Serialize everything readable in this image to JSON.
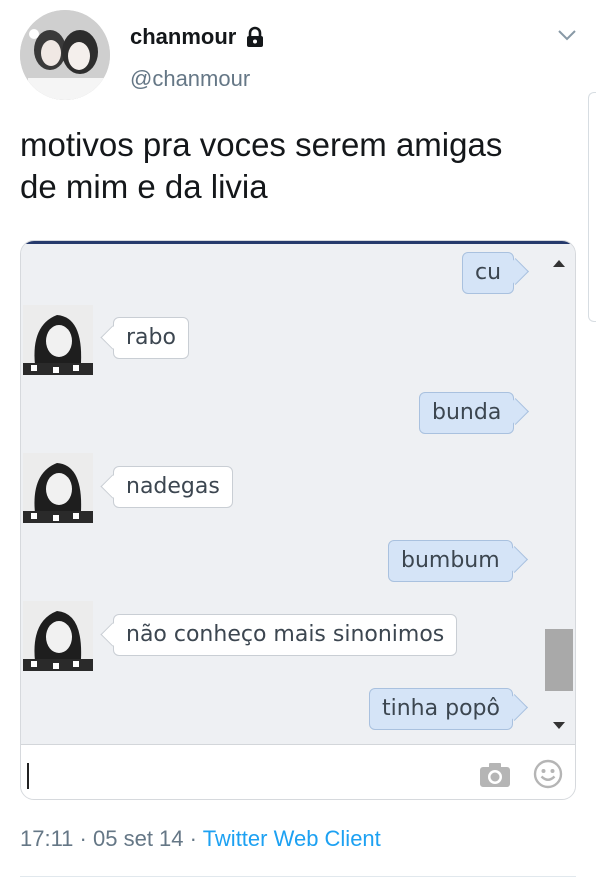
{
  "tweet": {
    "display_name": "chanmour",
    "handle": "@chanmour",
    "text_line1": "motivos pra voces serem amigas",
    "text_line2": "de mim e da livia",
    "time": "17:11",
    "separator": "·",
    "date": "05 set 14",
    "client": "Twitter Web Client"
  },
  "chat": {
    "messages": [
      {
        "from": "me",
        "text": "cu"
      },
      {
        "from": "them",
        "text": "rabo"
      },
      {
        "from": "me",
        "text": "bunda"
      },
      {
        "from": "them",
        "text": "nadegas"
      },
      {
        "from": "me",
        "text": "bumbum"
      },
      {
        "from": "them",
        "text": "não conheço mais sinonimos"
      },
      {
        "from": "me",
        "text": "tinha popô"
      }
    ]
  },
  "colors": {
    "link_blue": "#1da1f2",
    "muted_text": "#657786",
    "my_bubble": "#d5e4f7",
    "their_bubble": "#ffffff"
  },
  "icons": [
    "lock-icon",
    "chevron-down-icon",
    "scroll-up-arrow-icon",
    "scroll-down-arrow-icon",
    "camera-icon",
    "smiley-icon"
  ]
}
